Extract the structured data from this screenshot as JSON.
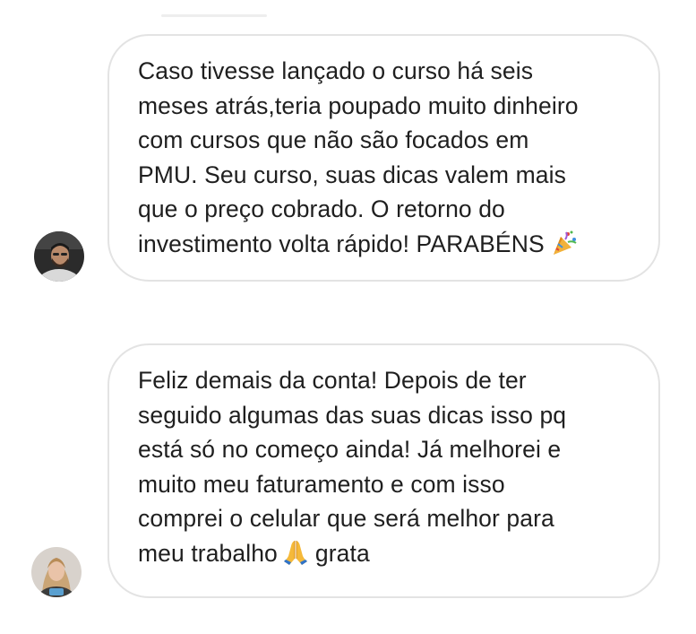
{
  "comments": [
    {
      "avatar": "man-with-beard-avatar",
      "lines": [
        "Caso tivesse lançado o curso há seis",
        "meses atrás,teria poupado muito dinheiro",
        "com cursos que não são focados em",
        "PMU. Seu curso, suas dicas valem mais",
        "que o preço cobrado. O retorno do",
        "investimento volta rápido! PARABÉNS"
      ],
      "emoji": "party-popper-icon"
    },
    {
      "avatar": "woman-avatar",
      "lines": [
        "Feliz demais da conta! Depois de ter",
        "seguido algumas das suas dicas isso pq",
        "está só no começo ainda! Já melhorei e",
        "muito meu faturamento e com isso",
        "comprei o celular que será melhor para",
        "meu trabalho"
      ],
      "emoji": "folded-hands-icon",
      "after_emoji": "grata"
    }
  ],
  "colors": {
    "bubble_border": "#e3e3e3",
    "text": "#1f1f1f",
    "background": "#ffffff"
  }
}
